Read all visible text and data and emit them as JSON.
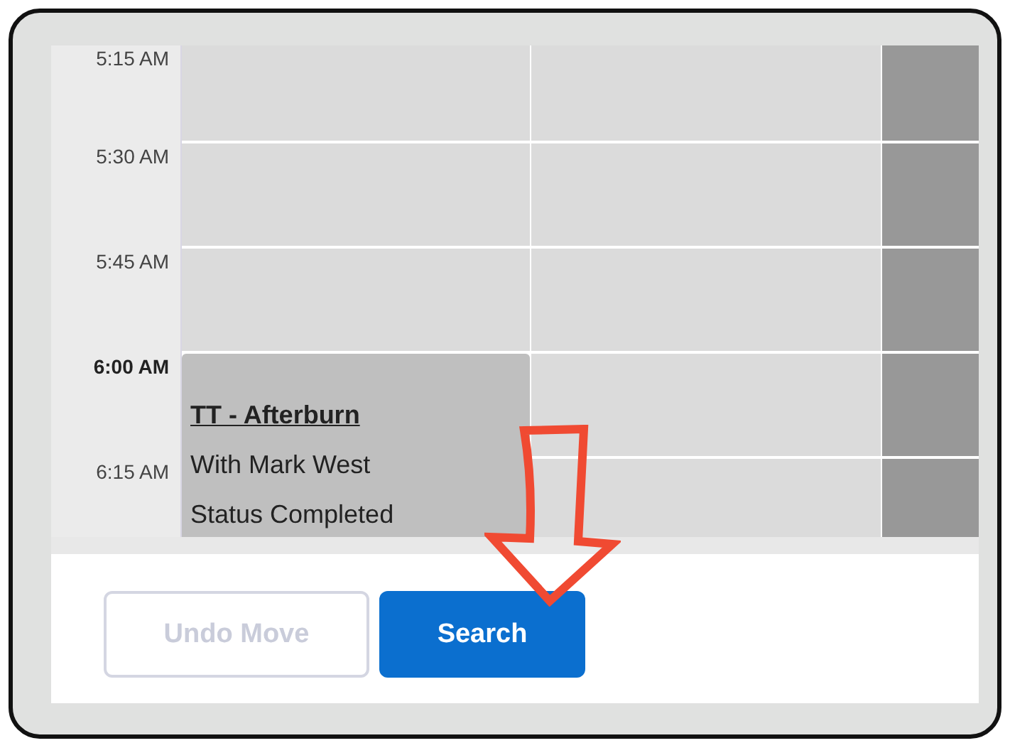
{
  "times": [
    {
      "label": "5:15 AM",
      "current": false
    },
    {
      "label": "5:30 AM",
      "current": false
    },
    {
      "label": "5:45 AM",
      "current": false
    },
    {
      "label": "6:00 AM",
      "current": true
    },
    {
      "label": "6:15 AM",
      "current": false
    }
  ],
  "columns": [
    {
      "blocked": false
    },
    {
      "blocked": false
    },
    {
      "blocked": true
    }
  ],
  "event": {
    "title": "TT - Afterburn",
    "lines": [
      "With Mark West",
      "Status Completed"
    ]
  },
  "buttons": [
    {
      "label": "Undo Move",
      "disabled": true,
      "kind": "secondary"
    },
    {
      "label": "Search",
      "disabled": false,
      "kind": "primary"
    }
  ]
}
